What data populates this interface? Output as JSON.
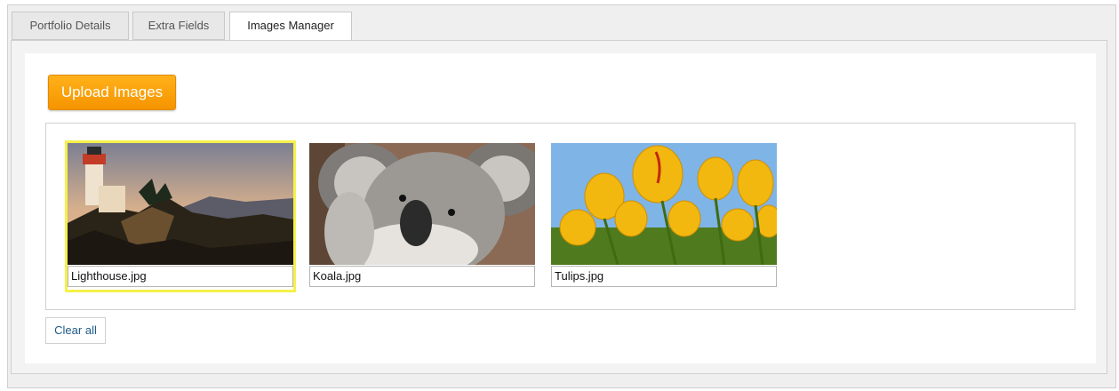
{
  "tabs": [
    {
      "label": "Portfolio Details"
    },
    {
      "label": "Extra Fields"
    },
    {
      "label": "Images Manager"
    }
  ],
  "active_tab": "Images Manager",
  "upload_label": "Upload Images",
  "images": [
    {
      "filename": "Lighthouse.jpg",
      "selected": true
    },
    {
      "filename": "Koala.jpg",
      "selected": false
    },
    {
      "filename": "Tulips.jpg",
      "selected": false
    }
  ],
  "clear_label": "Clear all",
  "colors": {
    "accent": "#f59400",
    "selected_outline": "#f5f14a",
    "link": "#1f5a86"
  }
}
